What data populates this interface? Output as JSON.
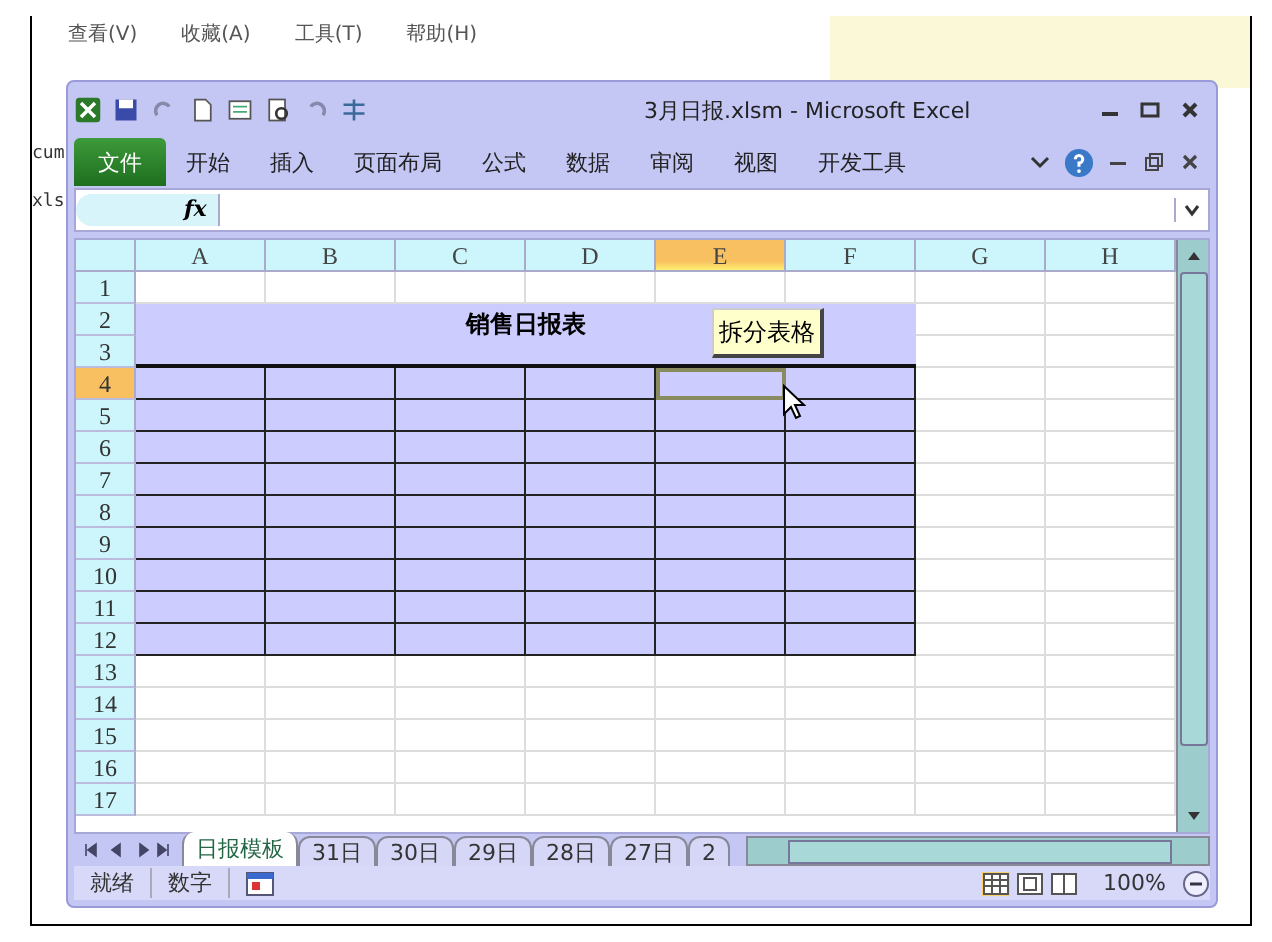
{
  "background_menu": [
    "查看(V)",
    "收藏(A)",
    "工具(T)",
    "帮助(H)"
  ],
  "background_fragments": [
    "cum",
    "xls"
  ],
  "window": {
    "title": "3月日报.xlsm  -  Microsoft Excel"
  },
  "ribbon_tabs": [
    {
      "label": "文件",
      "kind": "file"
    },
    {
      "label": "开始",
      "kind": "tab"
    },
    {
      "label": "插入",
      "kind": "tab"
    },
    {
      "label": "页面布局",
      "kind": "tab"
    },
    {
      "label": "公式",
      "kind": "tab"
    },
    {
      "label": "数据",
      "kind": "tab"
    },
    {
      "label": "审阅",
      "kind": "tab"
    },
    {
      "label": "视图",
      "kind": "tab"
    },
    {
      "label": "开发工具",
      "kind": "tab"
    }
  ],
  "formula_bar": {
    "function_label": "fx"
  },
  "sheet": {
    "columns": [
      {
        "label": "A",
        "selected": false
      },
      {
        "label": "B",
        "selected": false
      },
      {
        "label": "C",
        "selected": false
      },
      {
        "label": "D",
        "selected": false
      },
      {
        "label": "E",
        "selected": true
      },
      {
        "label": "F",
        "selected": false
      },
      {
        "label": "G",
        "selected": false
      },
      {
        "label": "H",
        "selected": false
      }
    ],
    "title": "销售日报表",
    "button": "拆分表格",
    "rows": [
      {
        "label": "1",
        "kind": "blank",
        "selected": false
      },
      {
        "label": "2",
        "kind": "title",
        "selected": false
      },
      {
        "label": "3",
        "kind": "title",
        "selected": false
      },
      {
        "label": "4",
        "kind": "table",
        "selected": true
      },
      {
        "label": "5",
        "kind": "table",
        "selected": false
      },
      {
        "label": "6",
        "kind": "table",
        "selected": false
      },
      {
        "label": "7",
        "kind": "table",
        "selected": false
      },
      {
        "label": "8",
        "kind": "table",
        "selected": false
      },
      {
        "label": "9",
        "kind": "table",
        "selected": false
      },
      {
        "label": "10",
        "kind": "table",
        "selected": false
      },
      {
        "label": "11",
        "kind": "table",
        "selected": false
      },
      {
        "label": "12",
        "kind": "table",
        "selected": false
      },
      {
        "label": "13",
        "kind": "blank",
        "selected": false
      },
      {
        "label": "14",
        "kind": "blank",
        "selected": false
      },
      {
        "label": "15",
        "kind": "blank",
        "selected": false
      },
      {
        "label": "16",
        "kind": "blank",
        "selected": false
      },
      {
        "label": "17",
        "kind": "blank",
        "selected": false
      }
    ]
  },
  "sheet_tabs": [
    {
      "label": "日报模板",
      "selected": true
    },
    {
      "label": "31日",
      "selected": false
    },
    {
      "label": "30日",
      "selected": false
    },
    {
      "label": "29日",
      "selected": false
    },
    {
      "label": "28日",
      "selected": false
    },
    {
      "label": "27日",
      "selected": false
    },
    {
      "label": "2",
      "selected": false
    }
  ],
  "status_bar": {
    "items": [
      "就绪",
      "数字"
    ],
    "zoom": "100%"
  }
}
